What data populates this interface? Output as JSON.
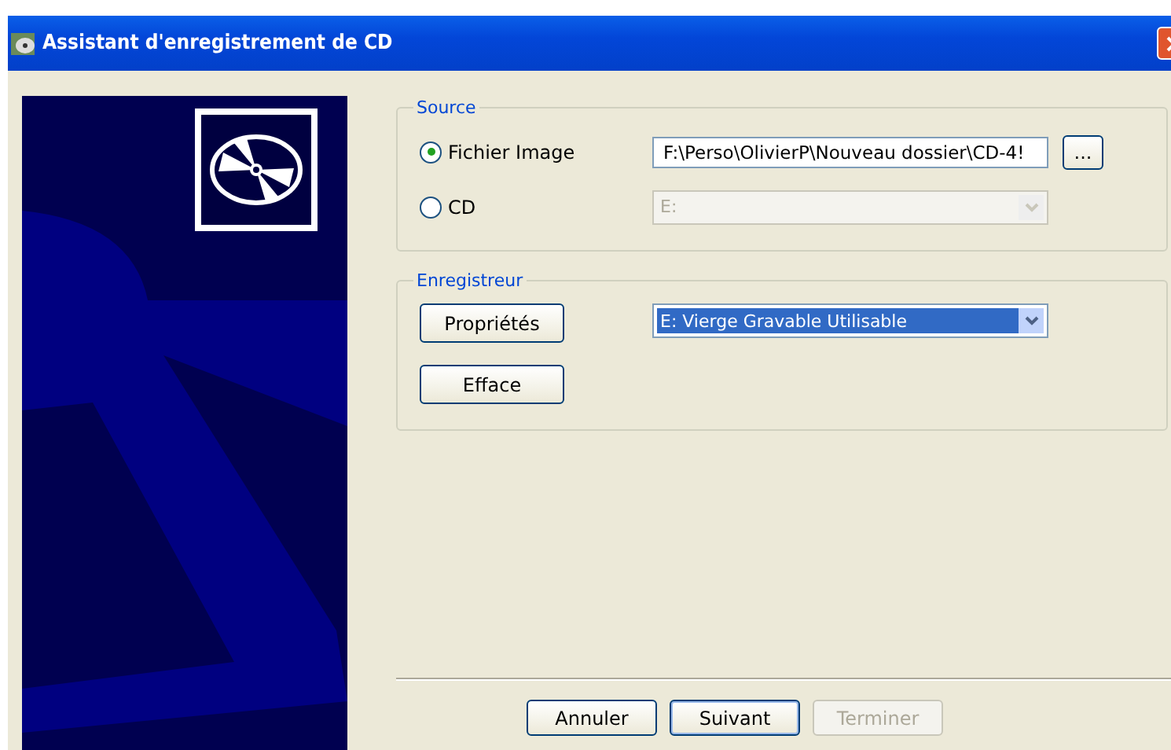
{
  "window": {
    "title": "Assistant d'enregistrement de CD"
  },
  "source": {
    "title": "Source",
    "options": [
      {
        "label": "Fichier Image",
        "selected": true,
        "kind": "field",
        "value": "F:\\Perso\\OlivierP\\Nouveau dossier\\CD-4!",
        "button": "...",
        "disabled": false
      },
      {
        "label": "CD",
        "selected": false,
        "kind": "combo",
        "value": "E:",
        "disabled": true
      }
    ]
  },
  "recorder": {
    "title": "Enregistreur",
    "buttons": [
      "Propriétés",
      "Efface"
    ],
    "drive": {
      "value": "E: Vierge Gravable Utilisable",
      "highlighted": true
    }
  },
  "footer_buttons": [
    {
      "label": "Annuler",
      "disabled": false,
      "default": false
    },
    {
      "label": "Suivant",
      "disabled": false,
      "default": true
    },
    {
      "label": "Terminer",
      "disabled": true,
      "default": false
    }
  ]
}
